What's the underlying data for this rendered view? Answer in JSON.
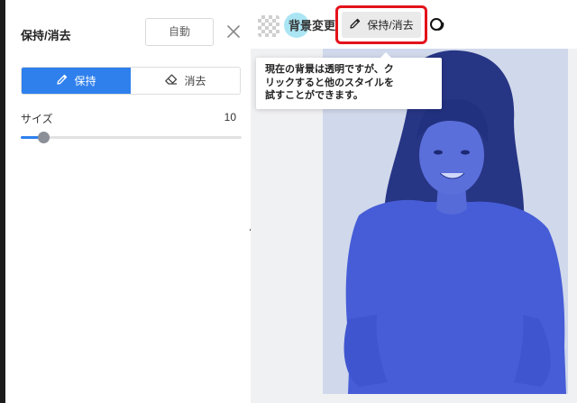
{
  "panel": {
    "title": "保持/消去",
    "auto_label": "自動",
    "modes": [
      {
        "label": "保持",
        "active": true
      },
      {
        "label": "消去",
        "active": false
      }
    ],
    "size_label": "サイズ",
    "size_value": "10",
    "slider_level_fraction": 0.1
  },
  "toolbar": {
    "bg_change_label": "背景変更",
    "keep_erase_label": "保持/消去"
  },
  "tooltip": {
    "line1": "現在の背景は透明ですが、ク",
    "line2": "リックすると他のスタイルを",
    "line3": "試すことができます。"
  },
  "colors": {
    "accent": "#2f80ed",
    "highlight_border": "#e3121b",
    "mask_overlay": "#2a55d6"
  }
}
